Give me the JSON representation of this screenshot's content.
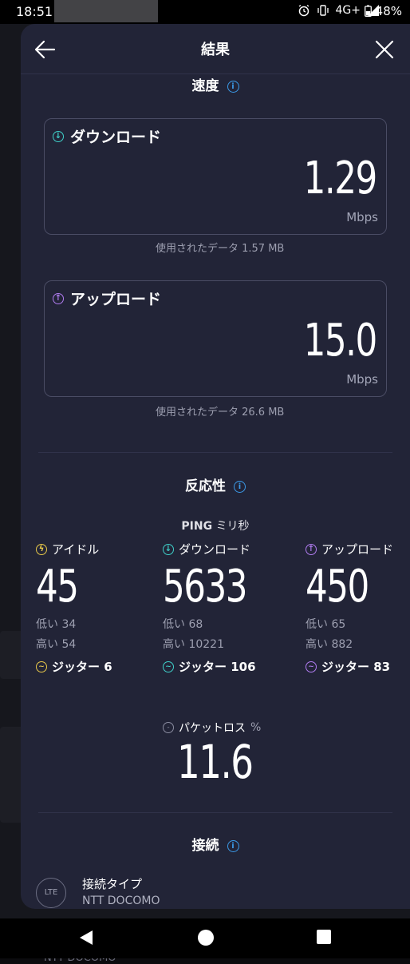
{
  "status_bar": {
    "time": "18:51",
    "network": "4G+",
    "battery": "48%"
  },
  "header": {
    "title": "結果"
  },
  "speed": {
    "section_title": "速度",
    "download": {
      "label": "ダウンロード",
      "value": "1.29",
      "unit": "Mbps",
      "data_used": "使用されたデータ 1.57 MB"
    },
    "upload": {
      "label": "アップロード",
      "value": "15.0",
      "unit": "Mbps",
      "data_used": "使用されたデータ 26.6 MB"
    }
  },
  "responsiveness": {
    "section_title": "反応性",
    "ping_label": "PING",
    "ping_unit": "ミリ秒",
    "columns": [
      {
        "label": "アイドル",
        "value": "45",
        "low": "低い 34",
        "high": "高い 54",
        "jitter": "ジッター 6",
        "color": "#e8c84a"
      },
      {
        "label": "ダウンロード",
        "value": "5633",
        "low": "低い 68",
        "high": "高い 10221",
        "jitter": "ジッター 106",
        "color": "#3fd0c9"
      },
      {
        "label": "アップロード",
        "value": "450",
        "low": "低い 65",
        "high": "高い 882",
        "jitter": "ジッター 83",
        "color": "#b07cf0"
      }
    ],
    "packet_loss": {
      "label": "パケットロス",
      "unit": "%",
      "value": "11.6"
    }
  },
  "connection": {
    "section_title": "接続",
    "badge": "LTE",
    "type_label": "接続タイプ",
    "type_value": "NTT DOCOMO"
  },
  "background_text": "NTT DOCOMO",
  "icons": {
    "back": "arrow-left-icon",
    "close": "close-icon",
    "info": "info-icon",
    "download": "arrow-down-circle-icon",
    "upload": "arrow-up-circle-icon",
    "idle": "bolt-circle-icon",
    "jitter": "wave-circle-icon",
    "packet_loss": "packet-loss-icon",
    "connection": "lte-icon"
  },
  "colors": {
    "accent_info": "#3b9ae8",
    "download": "#3fd0c9",
    "upload": "#b07cf0",
    "idle": "#e8c84a"
  }
}
